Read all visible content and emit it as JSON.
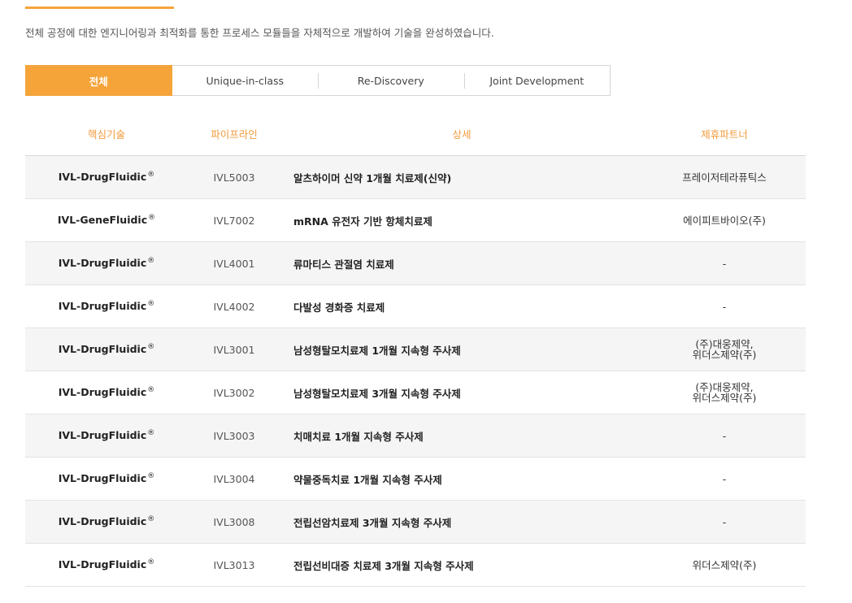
{
  "intro": "전체 공정에 대한 엔지니어링과 최적화를 통한 프로세스 모듈들을 자체적으로 개발하여 기술을 완성하였습니다.",
  "tabs": [
    {
      "label": "전체",
      "active": true
    },
    {
      "label": "Unique-in-class",
      "active": false
    },
    {
      "label": "Re-Discovery",
      "active": false
    },
    {
      "label": "Joint Development",
      "active": false
    }
  ],
  "table": {
    "headers": [
      "핵심기술",
      "파이프라인",
      "상세",
      "제휴파트너"
    ],
    "rows": [
      {
        "tech": "IVL-DrugFluidic",
        "reg": "®",
        "code": "IVL5003",
        "detail": "알츠하이머 신약 1개월 치료제(신약)",
        "partner1": "프레이저테라퓨틱스",
        "partner2": ""
      },
      {
        "tech": "IVL-GeneFluidic",
        "reg": "®",
        "code": "IVL7002",
        "detail": "mRNA 유전자 기반 항체치료제",
        "partner1": "에이피트바이오(주)",
        "partner2": ""
      },
      {
        "tech": "IVL-DrugFluidic",
        "reg": "®",
        "code": "IVL4001",
        "detail": "류마티스 관절염 치료제",
        "partner1": "-",
        "partner2": ""
      },
      {
        "tech": "IVL-DrugFluidic",
        "reg": "®",
        "code": "IVL4002",
        "detail": "다발성 경화증 치료제",
        "partner1": "-",
        "partner2": ""
      },
      {
        "tech": "IVL-DrugFluidic",
        "reg": "®",
        "code": "IVL3001",
        "detail": "남성형탈모치료제 1개월 지속형 주사제",
        "partner1": "(주)대웅제약,",
        "partner2": "위더스제약(주)"
      },
      {
        "tech": "IVL-DrugFluidic",
        "reg": "®",
        "code": "IVL3002",
        "detail": "남성형탈모치료제 3개월 지속형 주사제",
        "partner1": "(주)대웅제약,",
        "partner2": "위더스제약(주)"
      },
      {
        "tech": "IVL-DrugFluidic",
        "reg": "®",
        "code": "IVL3003",
        "detail": "치매치료 1개월 지속형 주사제",
        "partner1": "-",
        "partner2": ""
      },
      {
        "tech": "IVL-DrugFluidic",
        "reg": "®",
        "code": "IVL3004",
        "detail": "약물중독치료 1개월 지속형 주사제",
        "partner1": "-",
        "partner2": ""
      },
      {
        "tech": "IVL-DrugFluidic",
        "reg": "®",
        "code": "IVL3008",
        "detail": "전립선암치료제 3개월 지속형 주사제",
        "partner1": "-",
        "partner2": ""
      },
      {
        "tech": "IVL-DrugFluidic",
        "reg": "®",
        "code": "IVL3013",
        "detail": "전립선비대증 치료제 3개월 지속형 주사제",
        "partner1": "위더스제약(주)",
        "partner2": ""
      }
    ]
  },
  "colors": {
    "accent": "#f5a43a",
    "header_text": "#f19a3b",
    "row_alt": "#f5f5f5"
  }
}
